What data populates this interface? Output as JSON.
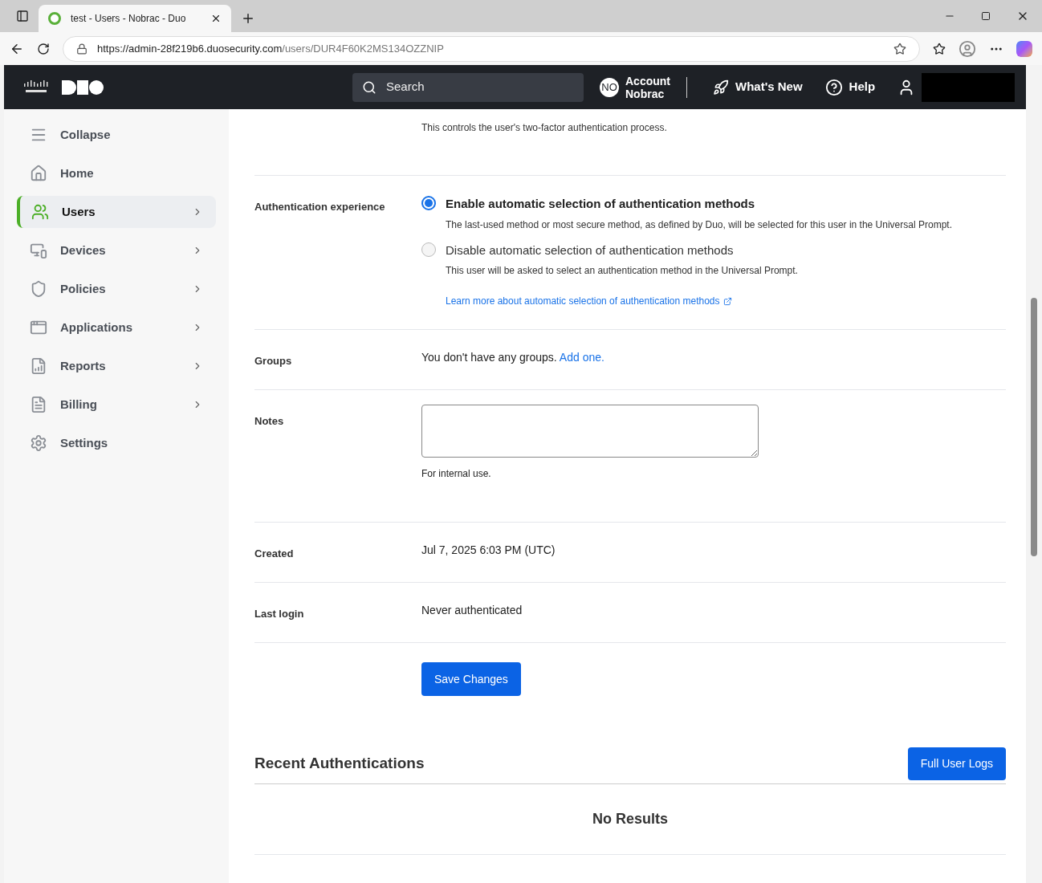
{
  "browser": {
    "tab_title": "test - Users - Nobrac - Duo",
    "url_host": "https://admin-28f219b6.duosecurity.com",
    "url_path": "/users/DUR4F60K2MS134OZZNIP"
  },
  "header": {
    "search_placeholder": "Search",
    "account_initials": "NO",
    "account_label": "Account",
    "account_name": "Nobrac",
    "whats_new": "What's New",
    "help": "Help"
  },
  "sidebar": {
    "items": [
      {
        "label": "Collapse",
        "selected": false,
        "expandable": false
      },
      {
        "label": "Home",
        "selected": false,
        "expandable": false
      },
      {
        "label": "Users",
        "selected": true,
        "expandable": true
      },
      {
        "label": "Devices",
        "selected": false,
        "expandable": true
      },
      {
        "label": "Policies",
        "selected": false,
        "expandable": true
      },
      {
        "label": "Applications",
        "selected": false,
        "expandable": true
      },
      {
        "label": "Reports",
        "selected": false,
        "expandable": true
      },
      {
        "label": "Billing",
        "selected": false,
        "expandable": true
      },
      {
        "label": "Settings",
        "selected": false,
        "expandable": false
      }
    ]
  },
  "status_help": "This controls the user's two-factor authentication process.",
  "auth_experience": {
    "label": "Authentication experience",
    "options": [
      {
        "title": "Enable automatic selection of authentication methods",
        "description": "The last-used method or most secure method, as defined by Duo, will be selected for this user in the Universal Prompt.",
        "selected": true
      },
      {
        "title": "Disable automatic selection of authentication methods",
        "description": "This user will be asked to select an authentication method in the Universal Prompt.",
        "selected": false
      }
    ],
    "link": "Learn more about automatic selection of authentication methods"
  },
  "groups": {
    "label": "Groups",
    "text": "You don't have any groups.",
    "link": "Add one."
  },
  "notes": {
    "label": "Notes",
    "hint": "For internal use."
  },
  "created": {
    "label": "Created",
    "value": "Jul 7, 2025 6:03 PM (UTC)"
  },
  "last_login": {
    "label": "Last login",
    "value": "Never authenticated"
  },
  "save_button": "Save Changes",
  "recent": {
    "title": "Recent Authentications",
    "button": "Full User Logs",
    "empty": "No Results"
  }
}
